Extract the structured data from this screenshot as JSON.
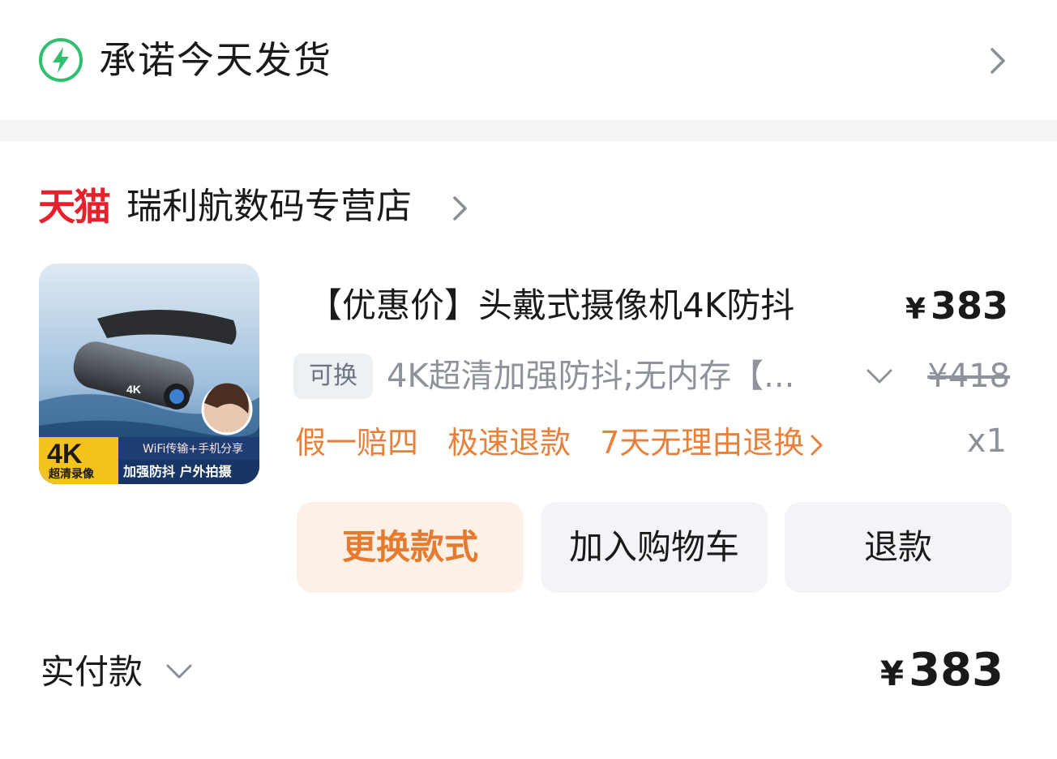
{
  "shipping": {
    "promise_text": "承诺今天发货",
    "icon": "lightning-bolt-icon",
    "accent_color": "#2fbf6e"
  },
  "store": {
    "platform_logo": "天猫",
    "name": "瑞利航数码专营店",
    "logo_color": "#e8202c"
  },
  "product": {
    "title": "【优惠价】头戴式摄像机4K防抖",
    "price_symbol": "¥",
    "price": "383",
    "swap_badge": "可换",
    "variant": "4K超清加强防抖;无内存【...",
    "original_price": "¥418",
    "quantity": "x1",
    "guarantees": [
      "假一赔四",
      "极速退款",
      "7天无理由退换"
    ],
    "guarantee_color": "#e9803a",
    "thumbnail": {
      "badge_4k": "4K",
      "badge_4k_sub": "超清录像",
      "tag_wifi": "WiFi传输+手机分享",
      "tag_features": "加强防抖 户外拍摄",
      "device_label": "4K"
    }
  },
  "actions": {
    "change_style": "更换款式",
    "add_to_cart": "加入购物车",
    "refund": "退款"
  },
  "payment": {
    "label": "实付款",
    "symbol": "¥",
    "amount": "383"
  }
}
